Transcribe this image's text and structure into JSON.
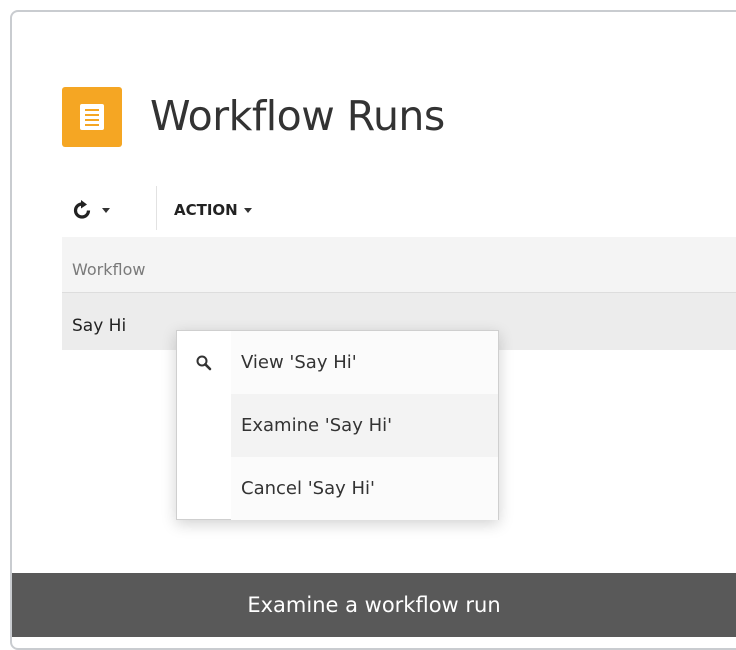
{
  "page": {
    "title": "Workflow Runs",
    "icon": "table-list-icon",
    "accent_color": "#f5a623"
  },
  "toolbar": {
    "refresh_icon": "refresh-icon",
    "action_label": "ACTION"
  },
  "grid": {
    "columns": [
      "Workflow"
    ],
    "rows": [
      {
        "workflow": "Say Hi"
      }
    ]
  },
  "context_menu": {
    "items": [
      {
        "label": "View 'Say Hi'",
        "icon": "search-icon"
      },
      {
        "label": "Examine 'Say Hi'",
        "icon": ""
      },
      {
        "label": "Cancel 'Say Hi'",
        "icon": ""
      }
    ]
  },
  "caption": {
    "text": "Examine a workflow run"
  }
}
